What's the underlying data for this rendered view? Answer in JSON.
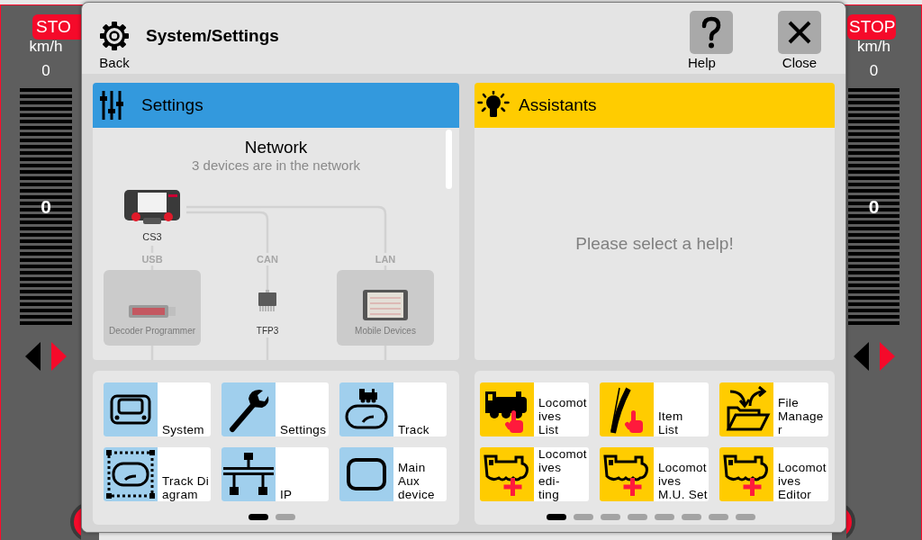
{
  "cabs": [
    {
      "stop": "STO",
      "unit": "km/h",
      "speed": "0",
      "bar_reading": "0",
      "level": 0,
      "directions": [
        {
          "kind": "reverse",
          "selected": false
        },
        {
          "kind": "forward",
          "selected": true
        }
      ]
    },
    {
      "stop": "STOP",
      "unit": "km/h",
      "speed": "0",
      "bar_reading": "0",
      "level": 0,
      "directions": [
        {
          "kind": "reverse",
          "selected": false
        },
        {
          "kind": "forward",
          "selected": true
        }
      ]
    }
  ],
  "dialog": {
    "title": "System/Settings",
    "back_label": "Back",
    "help_label": "Help",
    "close_label": "Close"
  },
  "settings_panel": {
    "title": "Settings",
    "network": {
      "title": "Network",
      "subtitle": "3 devices are in the network",
      "hub": {
        "name": "CS3"
      },
      "devices": [
        {
          "kind": "usb-stick",
          "connection": "USB",
          "name": "Decoder Programmer",
          "connected": false
        },
        {
          "kind": "chip",
          "connection": "CAN",
          "name": "TFP3",
          "connected": true
        },
        {
          "kind": "tablet",
          "connection": "LAN",
          "name": "Mobile Devices",
          "connected": false
        }
      ]
    }
  },
  "assistants_panel": {
    "title": "Assistants",
    "message": "Please select a help!"
  },
  "settings_tiles": {
    "tiles": [
      {
        "kind": "system",
        "label": "System"
      },
      {
        "kind": "wrench",
        "label": "Settings"
      },
      {
        "kind": "track",
        "label": "Track"
      },
      {
        "kind": "track-diagram",
        "label": "Track Di\nagram"
      },
      {
        "kind": "network",
        "label": "IP"
      },
      {
        "kind": "frame",
        "label": "Main\nAux\ndevice"
      }
    ],
    "pages": [
      {
        "selected": true
      },
      {
        "selected": false
      }
    ]
  },
  "assistant_tiles": {
    "tiles": [
      {
        "kind": "loco-pick",
        "label": "Locomot\nives\nList"
      },
      {
        "kind": "switch-pick",
        "label": "Item\nList"
      },
      {
        "kind": "folder",
        "label": "File\nManage\nr"
      },
      {
        "kind": "loco-add",
        "label": "Locomot\nives\nedi-\nting"
      },
      {
        "kind": "loco-add",
        "label": "Locomot\nives\nM.U. Set"
      },
      {
        "kind": "loco-add",
        "label": "Locomot\nives\nEditor"
      }
    ],
    "pages": [
      {
        "selected": true
      },
      {
        "selected": false
      },
      {
        "selected": false
      },
      {
        "selected": false
      },
      {
        "selected": false
      },
      {
        "selected": false
      },
      {
        "selected": false
      },
      {
        "selected": false
      }
    ]
  }
}
